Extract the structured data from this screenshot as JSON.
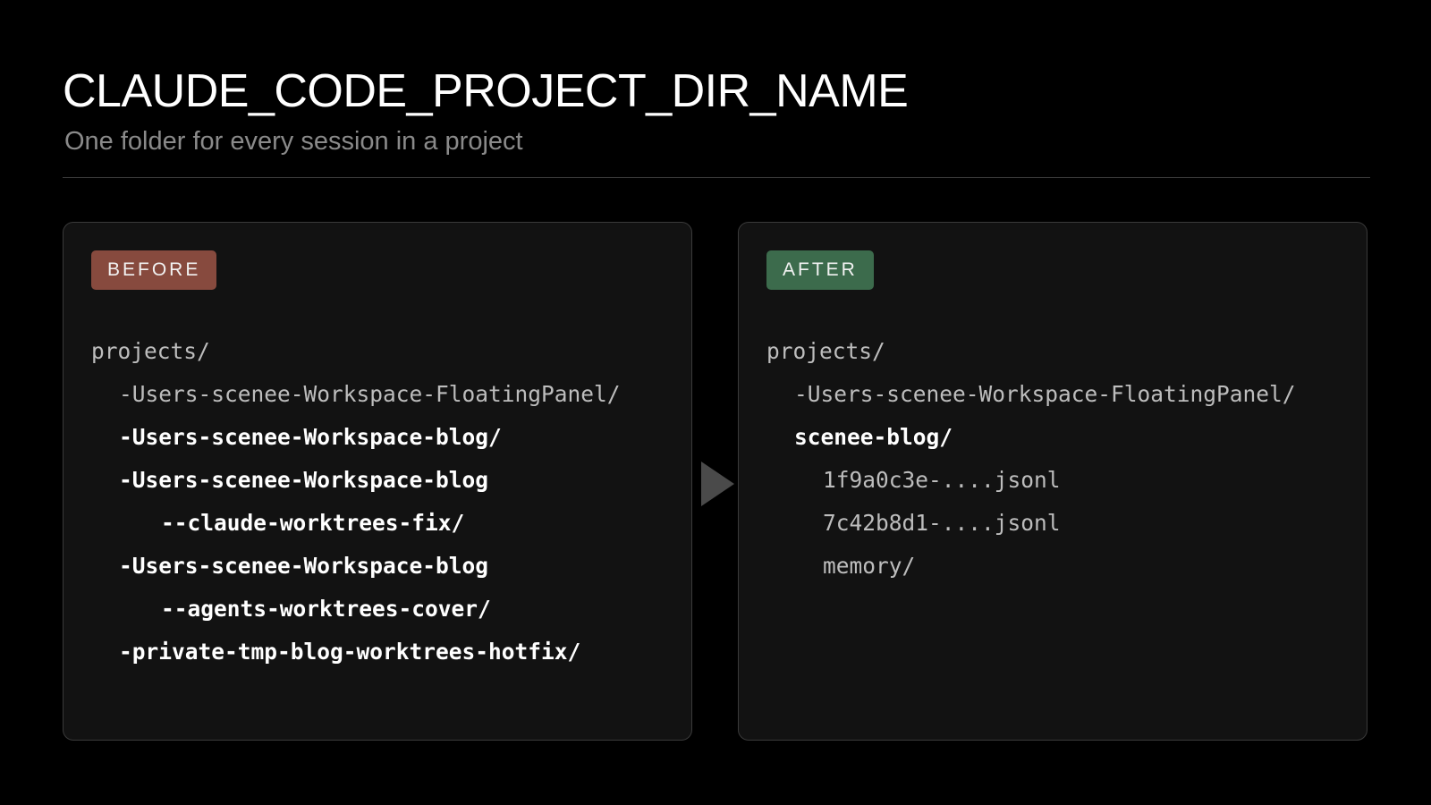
{
  "header": {
    "title": "CLAUDE_CODE_PROJECT_DIR_NAME",
    "subtitle": "One folder for every session in a project"
  },
  "before": {
    "badge": "BEFORE",
    "badge_color": "#874a3e",
    "lines": [
      {
        "text": "projects/",
        "indent": 0,
        "weight": "normal"
      },
      {
        "text": "-Users-scenee-Workspace-FloatingPanel/",
        "indent": 1,
        "weight": "normal"
      },
      {
        "text": "-Users-scenee-Workspace-blog/",
        "indent": 1,
        "weight": "bold"
      },
      {
        "text": "-Users-scenee-Workspace-blog",
        "indent": 1,
        "weight": "bold"
      },
      {
        "text": "--claude-worktrees-fix/",
        "indent": 2,
        "weight": "bold"
      },
      {
        "text": "-Users-scenee-Workspace-blog",
        "indent": 1,
        "weight": "bold"
      },
      {
        "text": "--agents-worktrees-cover/",
        "indent": 2,
        "weight": "bold"
      },
      {
        "text": "-private-tmp-blog-worktrees-hotfix/",
        "indent": 1,
        "weight": "bold"
      }
    ]
  },
  "after": {
    "badge": "AFTER",
    "badge_color": "#3c6b4c",
    "lines": [
      {
        "text": "projects/",
        "indent": 0,
        "weight": "normal"
      },
      {
        "text": "-Users-scenee-Workspace-FloatingPanel/",
        "indent": 1,
        "weight": "normal"
      },
      {
        "text": "scenee-blog/",
        "indent": 1,
        "weight": "bold"
      },
      {
        "text": "1f9a0c3e-....jsonl",
        "indent": 3,
        "weight": "normal"
      },
      {
        "text": "7c42b8d1-....jsonl",
        "indent": 3,
        "weight": "normal"
      },
      {
        "text": "memory/",
        "indent": 3,
        "weight": "normal"
      }
    ]
  },
  "icons": {
    "transition_arrow": "play-triangle-icon"
  }
}
